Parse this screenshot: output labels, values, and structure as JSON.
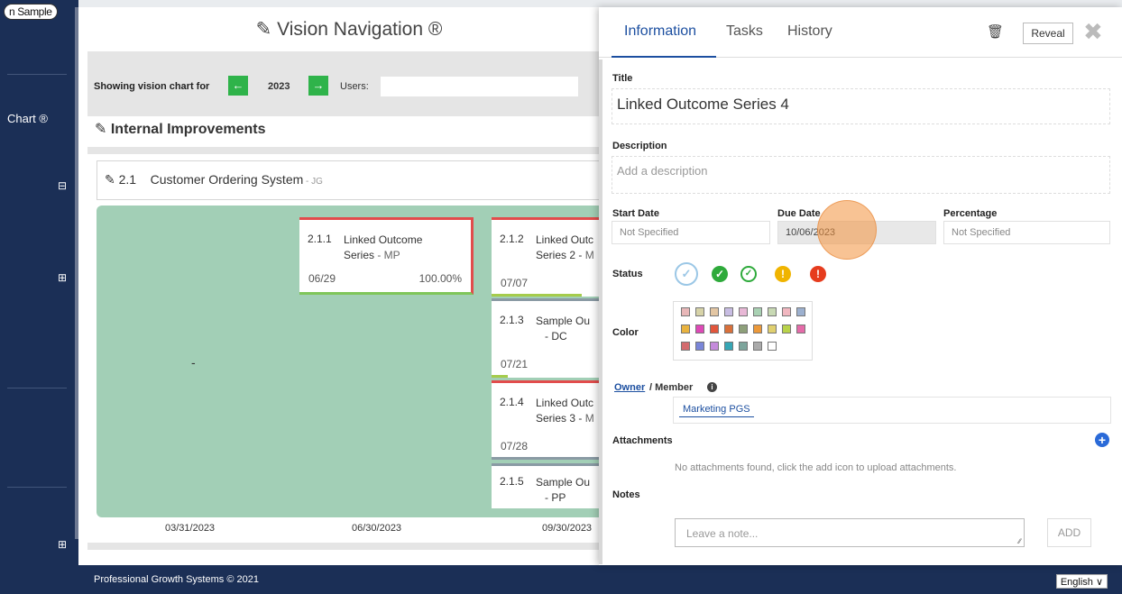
{
  "sidebar": {
    "sample_label": "n Sample",
    "chart_label": "Chart ®",
    "collapse_symbol": "⊟",
    "expand_symbol": "⊞"
  },
  "main": {
    "page_title": "Vision Navigation ®",
    "toolbar": {
      "showing_label": "Showing vision chart for",
      "year": "2023",
      "prev_arrow": "←",
      "next_arrow": "→",
      "users_label": "Users:"
    },
    "section_title": "Internal Improvements",
    "goal": {
      "number": "2.1",
      "title": "Customer Ordering System",
      "initials": " - JG"
    },
    "timeline_dash": "-",
    "cards": [
      {
        "num": "2.1.1",
        "title": "Linked Outcome",
        "title2": "Series",
        "initials": " - MP",
        "date": "06/29",
        "pct": "100.00%"
      },
      {
        "num": "2.1.2",
        "title": "Linked Outc",
        "title2": "Series 2 -",
        "initials": " M",
        "date": "07/07",
        "pct": ""
      },
      {
        "num": "2.1.3",
        "title": "Sample Ou",
        "title2": "",
        "initials": "- DC",
        "date": "07/21",
        "pct": ""
      },
      {
        "num": "2.1.4",
        "title": "Linked Outc",
        "title2": "Series 3 -",
        "initials": " M",
        "date": "07/28",
        "pct": ""
      },
      {
        "num": "2.1.5",
        "title": "Sample Ou",
        "title2": "",
        "initials": "- PP",
        "date": "",
        "pct": ""
      }
    ],
    "timeline_dates": [
      "03/31/2023",
      "06/30/2023",
      "09/30/2023"
    ]
  },
  "panel": {
    "tabs": [
      "Information",
      "Tasks",
      "History"
    ],
    "active_tab": "Information",
    "reveal_label": "Reveal",
    "close_symbol": "✖",
    "trash_symbol": "🗑",
    "title_label": "Title",
    "title_value": "Linked Outcome Series 4",
    "description_label": "Description",
    "description_placeholder": "Add a description",
    "start_date_label": "Start Date",
    "start_date_value": "Not Specified",
    "due_date_label": "Due Date",
    "due_date_value": "10/06/2023",
    "percentage_label": "Percentage",
    "percentage_value": "Not Specified",
    "status_label": "Status",
    "color_label": "Color",
    "owner_label": "Owner",
    "member_label": "/ Member",
    "owner_value": "Marketing PGS",
    "attachments_label": "Attachments",
    "no_attachments": "No attachments found, click the add icon to upload attachments.",
    "notes_label": "Notes",
    "note_placeholder": "Leave a note...",
    "add_label": "ADD",
    "status_colors": [
      "#9bc7e6",
      "#2eaa3b",
      "#2eaa3b",
      "#f0b400",
      "#e63c1e"
    ],
    "swatch_colors": [
      [
        "#e8b7b8",
        "#d7d3a8",
        "#e3c6a3",
        "#c8bde3",
        "#e8b8d6",
        "#a9d1b3",
        "#c8d9b4",
        "#f1b7c0",
        "#9cb0cf"
      ],
      [
        "#e9b33f",
        "#de49b7",
        "#e2563c",
        "#d9703a",
        "#8ea07b",
        "#ec993a",
        "#e0d06f",
        "#b9d34a",
        "#e56ba9"
      ],
      [
        "#d36b6e",
        "#7a86d9",
        "#c58bdb",
        "#36a6b5",
        "#7da59c",
        "#aaaaaa",
        "#ffffff"
      ]
    ]
  },
  "footer": {
    "copyright": "Professional Growth Systems © 2021",
    "language": "English ∨"
  }
}
